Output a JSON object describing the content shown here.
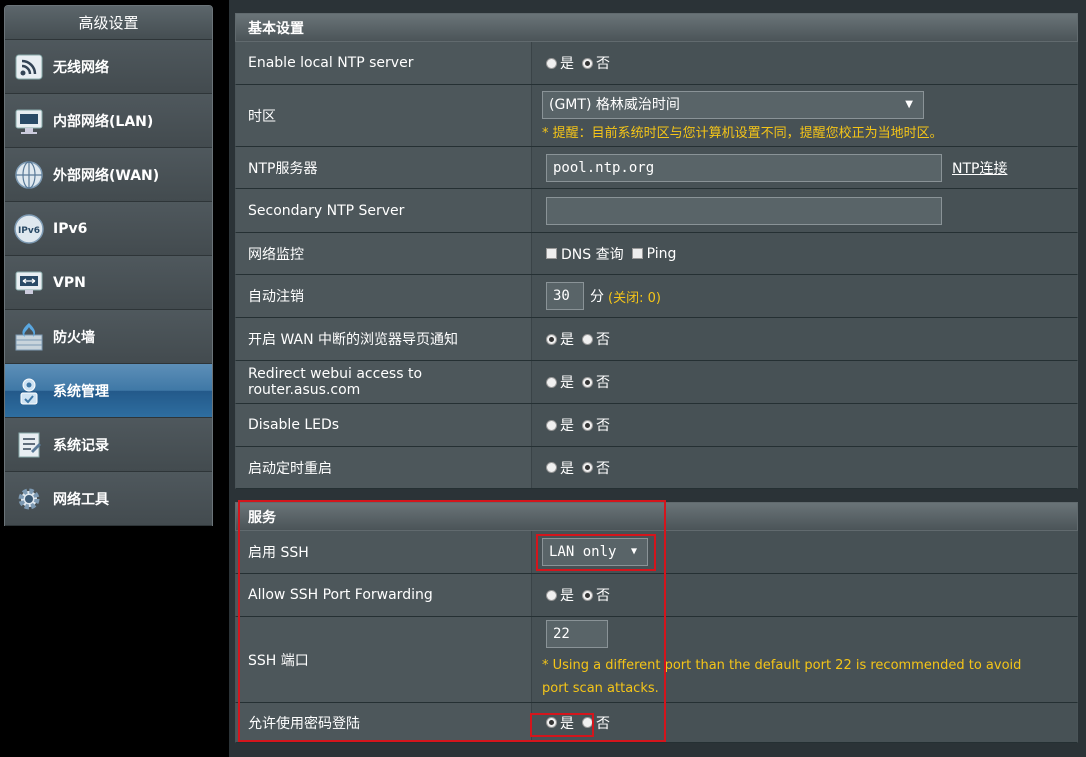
{
  "sidebar": {
    "title": "高级设置",
    "items": [
      {
        "label": "无线网络",
        "icon": "wireless-icon"
      },
      {
        "label": "内部网络(LAN)",
        "icon": "lan-icon"
      },
      {
        "label": "外部网络(WAN)",
        "icon": "globe-icon"
      },
      {
        "label": "IPv6",
        "icon": "ipv6-icon"
      },
      {
        "label": "VPN",
        "icon": "vpn-icon"
      },
      {
        "label": "防火墙",
        "icon": "firewall-icon"
      },
      {
        "label": "系统管理",
        "icon": "system-admin-icon"
      },
      {
        "label": "系统记录",
        "icon": "system-log-icon"
      },
      {
        "label": "网络工具",
        "icon": "network-tools-icon"
      }
    ],
    "active_index": 6
  },
  "basic": {
    "title": "基本设置",
    "ntp_local_label": "Enable local NTP server",
    "timezone_label": "时区",
    "timezone_value": "(GMT) 格林威治时间",
    "timezone_note": "* 提醒：目前系统时区与您计算机设置不同，提醒您校正为当地时区。",
    "ntp_server_label": "NTP服务器",
    "ntp_server_value": "pool.ntp.org",
    "ntp_link": "NTP连接",
    "secondary_ntp_label": "Secondary NTP Server",
    "secondary_ntp_value": "",
    "monitor_label": "网络监控",
    "monitor_dns": "DNS 查询",
    "monitor_ping": "Ping",
    "logout_label": "自动注销",
    "logout_value": "30",
    "logout_unit": "分",
    "logout_note": "(关闭: 0)",
    "wan_notify_label": "开启 WAN 中断的浏览器导页通知",
    "redirect_label": "Redirect webui access to router.asus.com",
    "leds_label": "Disable LEDs",
    "reboot_label": "启动定时重启",
    "yes": "是",
    "no": "否"
  },
  "service": {
    "title": "服务",
    "ssh_label": "启用 SSH",
    "ssh_value": "LAN only",
    "ssh_fwd_label": "Allow SSH Port Forwarding",
    "ssh_port_label": "SSH 端口",
    "ssh_port_value": "22",
    "ssh_port_note": "* Using a different port than the default port 22 is recommended to avoid port scan attacks.",
    "password_label": "允许使用密码登陆"
  }
}
